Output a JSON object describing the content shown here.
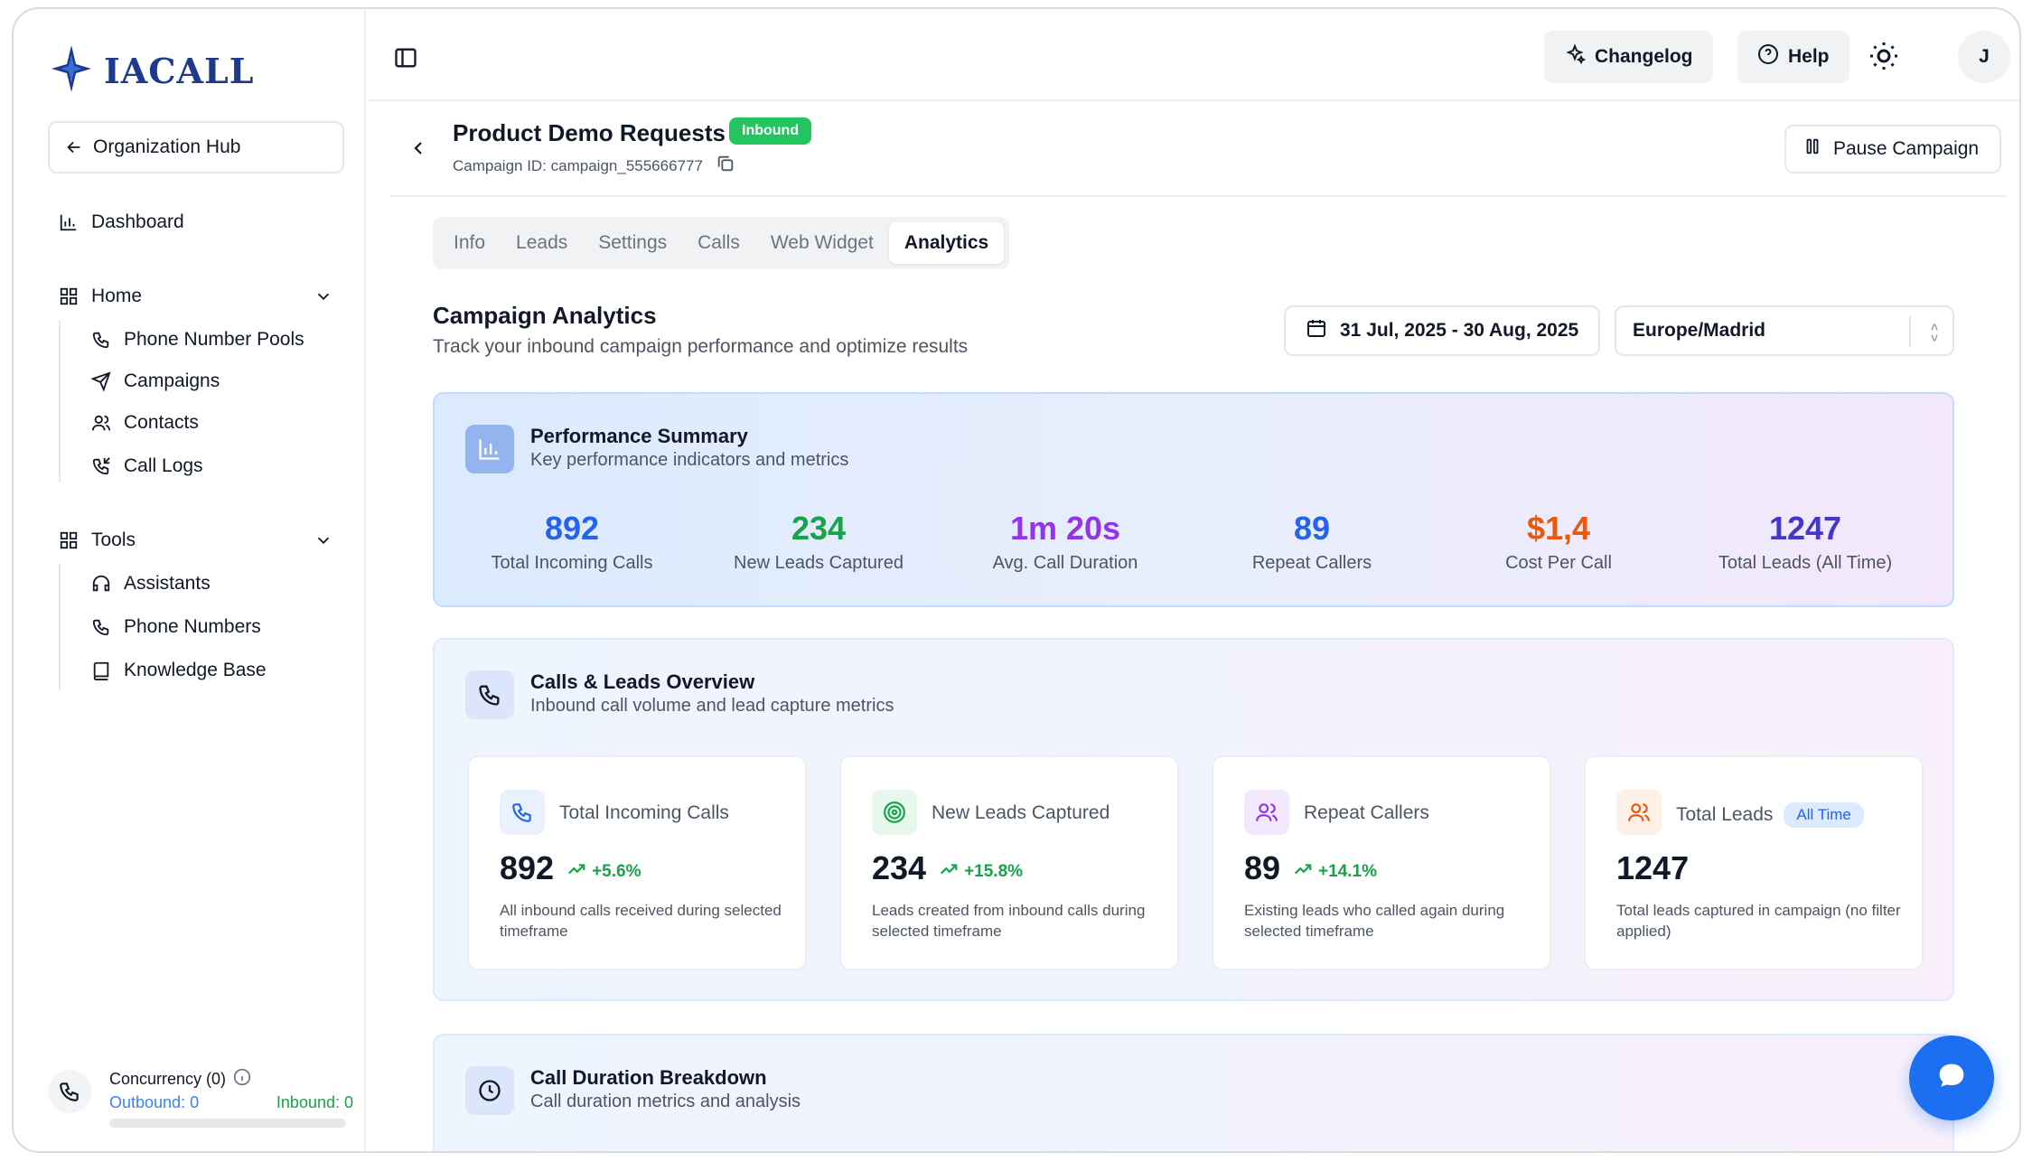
{
  "brand": {
    "name": "IACALL",
    "color": "#1e3a8a"
  },
  "sidebar": {
    "org_hub": "Organization Hub",
    "dashboard": "Dashboard",
    "home": {
      "label": "Home",
      "items": [
        "Phone Number Pools",
        "Campaigns",
        "Contacts",
        "Call Logs"
      ]
    },
    "tools": {
      "label": "Tools",
      "items": [
        "Assistants",
        "Phone Numbers",
        "Knowledge Base"
      ]
    },
    "concurrency": {
      "title": "Concurrency (0)",
      "outbound": "Outbound: 0",
      "inbound": "Inbound: 0"
    }
  },
  "topbar": {
    "changelog": "Changelog",
    "help": "Help",
    "avatar_initial": "J"
  },
  "campaign": {
    "title": "Product Demo Requests",
    "badge": "Inbound",
    "id_text": "Campaign ID: campaign_555666777",
    "pause_label": "Pause Campaign"
  },
  "tabs": [
    "Info",
    "Leads",
    "Settings",
    "Calls",
    "Web Widget",
    "Analytics"
  ],
  "active_tab": "Analytics",
  "analytics": {
    "title": "Campaign Analytics",
    "subtitle": "Track your inbound campaign performance and optimize results",
    "date_range": "31 Jul, 2025 - 30 Aug, 2025",
    "timezone": "Europe/Madrid"
  },
  "performance": {
    "title": "Performance Summary",
    "subtitle": "Key performance indicators and metrics",
    "kpis": [
      {
        "value": "892",
        "label": "Total Incoming Calls",
        "color": "#2563eb"
      },
      {
        "value": "234",
        "label": "New Leads Captured",
        "color": "#16a34a"
      },
      {
        "value": "1m 20s",
        "label": "Avg. Call Duration",
        "color": "#9333ea"
      },
      {
        "value": "89",
        "label": "Repeat Callers",
        "color": "#2563eb"
      },
      {
        "value": "$1,4",
        "label": "Cost Per Call",
        "color": "#ea580c"
      },
      {
        "value": "1247",
        "label": "Total Leads (All Time)",
        "color": "#4338ca"
      }
    ]
  },
  "overview": {
    "title": "Calls & Leads Overview",
    "subtitle": "Inbound call volume and lead capture metrics",
    "cards": [
      {
        "title": "Total Incoming Calls",
        "value": "892",
        "delta": "+5.6%",
        "desc": "All inbound calls received during selected timeframe",
        "icon": "phone-icon"
      },
      {
        "title": "New Leads Captured",
        "value": "234",
        "delta": "+15.8%",
        "desc": "Leads created from inbound calls during selected timeframe",
        "icon": "target-icon"
      },
      {
        "title": "Repeat Callers",
        "value": "89",
        "delta": "+14.1%",
        "desc": "Existing leads who called again during selected timeframe",
        "icon": "users-icon"
      },
      {
        "title": "Total Leads",
        "badge": "All Time",
        "value": "1247",
        "desc": "Total leads captured in campaign (no filter applied)",
        "icon": "users-icon"
      }
    ]
  },
  "duration": {
    "title": "Call Duration Breakdown",
    "subtitle": "Call duration metrics and analysis"
  }
}
